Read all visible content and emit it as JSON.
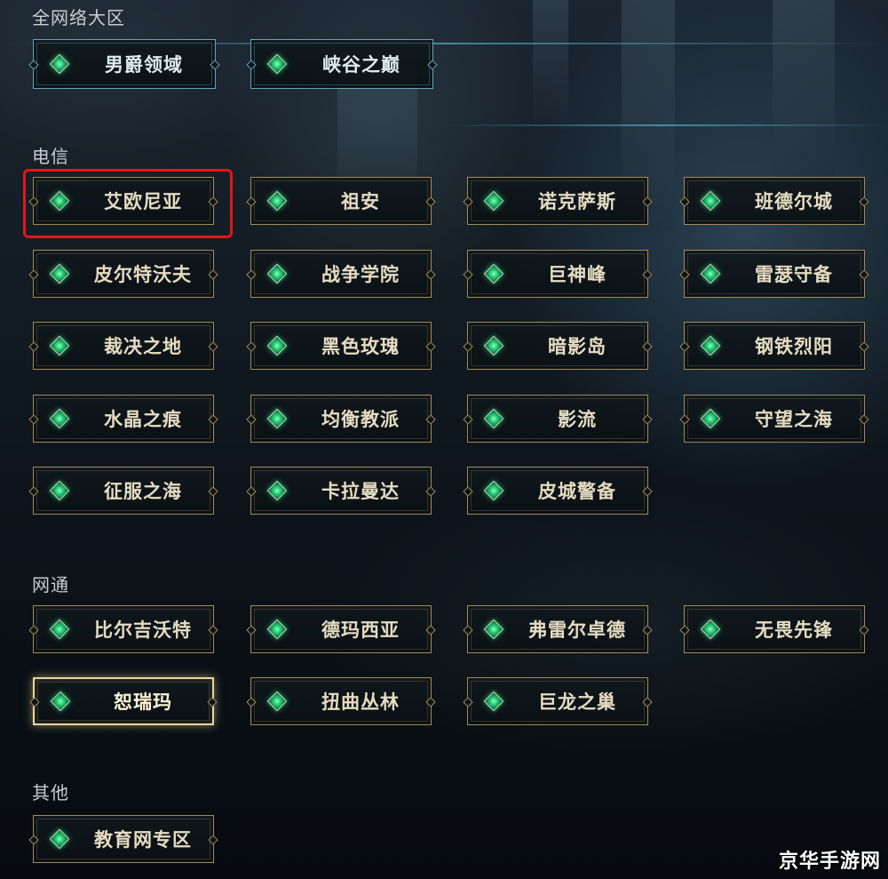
{
  "sections": {
    "global": {
      "label": "全网络大区",
      "servers": [
        "男爵领域",
        "峡谷之巅"
      ]
    },
    "telecom": {
      "label": "电信",
      "servers": [
        "艾欧尼亚",
        "祖安",
        "诺克萨斯",
        "班德尔城",
        "皮尔特沃夫",
        "战争学院",
        "巨神峰",
        "雷瑟守备",
        "裁决之地",
        "黑色玫瑰",
        "暗影岛",
        "钢铁烈阳",
        "水晶之痕",
        "均衡教派",
        "影流",
        "守望之海",
        "征服之海",
        "卡拉曼达",
        "皮城警备"
      ]
    },
    "netcom": {
      "label": "网通",
      "servers": [
        "比尔吉沃特",
        "德玛西亚",
        "弗雷尔卓德",
        "无畏先锋",
        "恕瑞玛",
        "扭曲丛林",
        "巨龙之巢"
      ]
    },
    "other": {
      "label": "其他",
      "servers": [
        "教育网专区"
      ]
    }
  },
  "selected_server": "恕瑞玛",
  "highlighted_server": "艾欧尼亚",
  "watermark": "京华手游网",
  "colors": {
    "button_border": "#a38a55",
    "global_button_border": "#5fa6b8",
    "selected_border": "#e8d59b",
    "highlight_box": "#e01818",
    "gem": "#1ec66f"
  }
}
